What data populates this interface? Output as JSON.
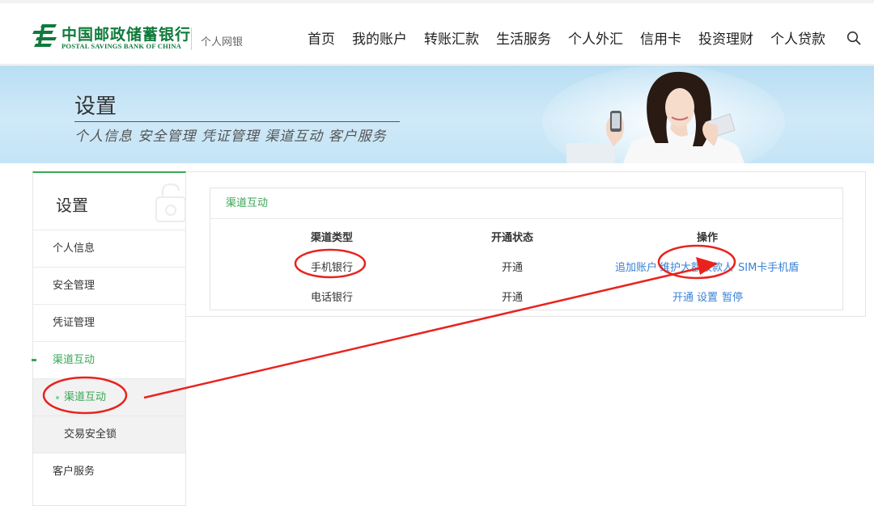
{
  "header": {
    "logo_cn": "中国邮政储蓄银行",
    "logo_en": "POSTAL SAVINGS BANK OF CHINA",
    "site_name": "个人网银",
    "nav": [
      "首页",
      "我的账户",
      "转账汇款",
      "生活服务",
      "个人外汇",
      "信用卡",
      "投资理财",
      "个人贷款"
    ],
    "search_icon": "search-icon"
  },
  "banner": {
    "title": "设置",
    "subtitle": "个人信息 安全管理 凭证管理 渠道互动 客户服务"
  },
  "sidebar": {
    "title": "设置",
    "items": [
      {
        "label": "个人信息"
      },
      {
        "label": "安全管理"
      },
      {
        "label": "凭证管理"
      },
      {
        "label": "渠道互动"
      },
      {
        "label": "渠道互动"
      },
      {
        "label": "交易安全锁"
      },
      {
        "label": "客户服务"
      }
    ]
  },
  "card": {
    "title": "渠道互动",
    "columns": [
      "渠道类型",
      "开通状态",
      "操作"
    ],
    "rows": [
      {
        "type": "手机银行",
        "status": "开通",
        "actions": [
          "追加账户",
          "维护大额收款人",
          "SIM卡手机盾"
        ]
      },
      {
        "type": "电话银行",
        "status": "开通",
        "actions": [
          "开通",
          "设置",
          "暂停"
        ]
      }
    ]
  },
  "colors": {
    "brand_green": "#0f7a3b",
    "accent_green": "#3aa655",
    "link_blue": "#3b82d6",
    "annotation_red": "#e8231e",
    "banner_blue": "#c4e4f6"
  }
}
